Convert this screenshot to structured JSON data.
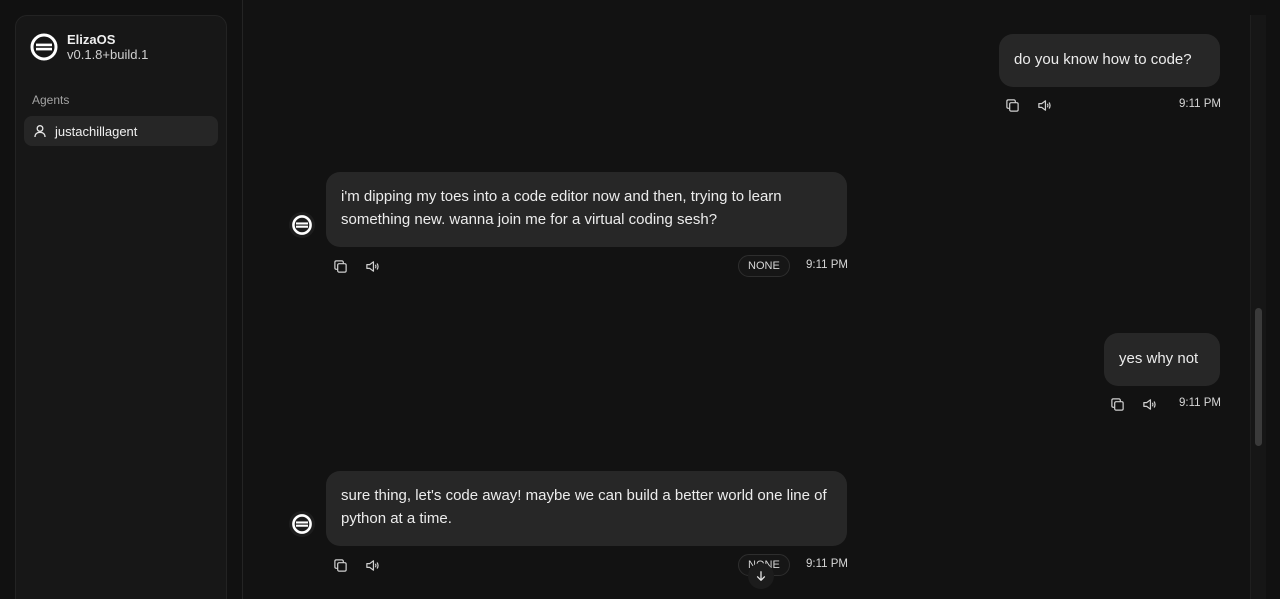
{
  "app": {
    "name": "ElizaOS",
    "version": "v0.1.8+build.1"
  },
  "sidebar": {
    "section_label": "Agents",
    "agents": [
      {
        "name": "justachillagent"
      }
    ]
  },
  "messages": [
    {
      "role": "user",
      "text": "do you know how to code?",
      "time": "9:11 PM"
    },
    {
      "role": "agent",
      "text": "i'm dipping my toes into a code editor now and then, trying to learn something new. wanna join me for a virtual coding sesh?",
      "action": "NONE",
      "time": "9:11 PM"
    },
    {
      "role": "user",
      "text": "yes why not",
      "time": "9:11 PM"
    },
    {
      "role": "agent",
      "text": "sure thing, let's code away! maybe we can build a better world one line of python at a time.",
      "action": "NONE",
      "time": "9:11 PM"
    }
  ],
  "icons": {
    "copy": "copy-icon",
    "speak": "speaker-icon",
    "user": "user-icon",
    "logo": "eliza-logo-icon",
    "scroll": "arrow-down-icon"
  }
}
